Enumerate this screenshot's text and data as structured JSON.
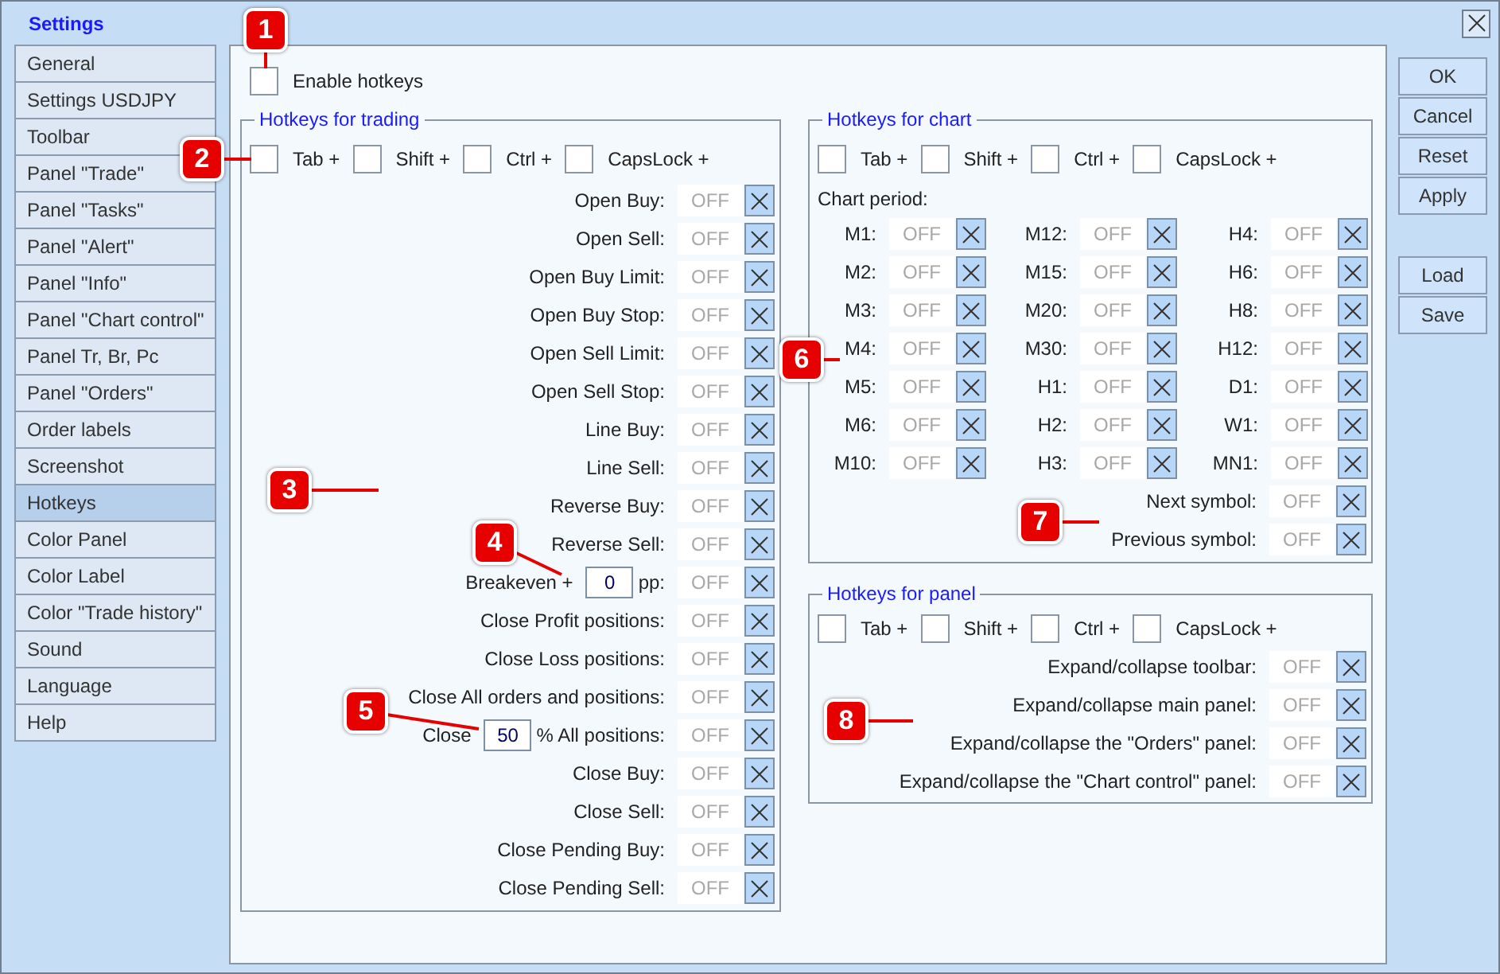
{
  "window": {
    "title": "Settings"
  },
  "sidebar": {
    "items": [
      {
        "label": "General",
        "selected": false
      },
      {
        "label": "Settings USDJPY",
        "selected": false
      },
      {
        "label": "Toolbar",
        "selected": false
      },
      {
        "label": "Panel \"Trade\"",
        "selected": false
      },
      {
        "label": "Panel \"Tasks\"",
        "selected": false
      },
      {
        "label": "Panel \"Alert\"",
        "selected": false
      },
      {
        "label": "Panel \"Info\"",
        "selected": false
      },
      {
        "label": "Panel \"Chart control\"",
        "selected": false
      },
      {
        "label": "Panel Tr, Br, Pc",
        "selected": false
      },
      {
        "label": "Panel \"Orders\"",
        "selected": false
      },
      {
        "label": "Order labels",
        "selected": false
      },
      {
        "label": "Screenshot",
        "selected": false
      },
      {
        "label": "Hotkeys",
        "selected": true
      },
      {
        "label": "Color Panel",
        "selected": false
      },
      {
        "label": "Color Label",
        "selected": false
      },
      {
        "label": "Color \"Trade history\"",
        "selected": false
      },
      {
        "label": "Sound",
        "selected": false
      },
      {
        "label": "Language",
        "selected": false
      },
      {
        "label": "Help",
        "selected": false
      }
    ]
  },
  "enable_hotkeys": {
    "label": "Enable hotkeys",
    "checked": false
  },
  "trading": {
    "title": "Hotkeys for trading",
    "modifiers": [
      {
        "label": "Tab +",
        "checked": false
      },
      {
        "label": "Shift +",
        "checked": false
      },
      {
        "label": "Ctrl +",
        "checked": false
      },
      {
        "label": "CapsLock +",
        "checked": false
      }
    ],
    "rows": [
      {
        "kind": "plain",
        "label": "Open Buy:",
        "value": "OFF"
      },
      {
        "kind": "plain",
        "label": "Open Sell:",
        "value": "OFF"
      },
      {
        "kind": "plain",
        "label": "Open Buy Limit:",
        "value": "OFF"
      },
      {
        "kind": "plain",
        "label": "Open Buy Stop:",
        "value": "OFF"
      },
      {
        "kind": "plain",
        "label": "Open Sell Limit:",
        "value": "OFF"
      },
      {
        "kind": "plain",
        "label": "Open Sell Stop:",
        "value": "OFF"
      },
      {
        "kind": "plain",
        "label": "Line Buy:",
        "value": "OFF"
      },
      {
        "kind": "plain",
        "label": "Line Sell:",
        "value": "OFF"
      },
      {
        "kind": "plain",
        "label": "Reverse Buy:",
        "value": "OFF"
      },
      {
        "kind": "plain",
        "label": "Reverse Sell:",
        "value": "OFF"
      },
      {
        "kind": "input",
        "prefix": "Breakeven +",
        "input": "0",
        "suffix": "pp:",
        "value": "OFF"
      },
      {
        "kind": "plain",
        "label": "Close Profit positions:",
        "value": "OFF"
      },
      {
        "kind": "plain",
        "label": "Close Loss positions:",
        "value": "OFF"
      },
      {
        "kind": "plain",
        "label": "Close All orders and positions:",
        "value": "OFF"
      },
      {
        "kind": "input",
        "prefix": "Close",
        "input": "50",
        "suffix": "% All positions:",
        "value": "OFF"
      },
      {
        "kind": "plain",
        "label": "Close Buy:",
        "value": "OFF"
      },
      {
        "kind": "plain",
        "label": "Close Sell:",
        "value": "OFF"
      },
      {
        "kind": "plain",
        "label": "Close Pending Buy:",
        "value": "OFF"
      },
      {
        "kind": "plain",
        "label": "Close Pending Sell:",
        "value": "OFF"
      }
    ]
  },
  "chart": {
    "title": "Hotkeys for chart",
    "modifiers": [
      {
        "label": "Tab +",
        "checked": false
      },
      {
        "label": "Shift +",
        "checked": false
      },
      {
        "label": "Ctrl +",
        "checked": false
      },
      {
        "label": "CapsLock +",
        "checked": false
      }
    ],
    "period_label": "Chart period:",
    "periods": [
      {
        "kind": "plain",
        "label": "M1:",
        "value": "OFF"
      },
      {
        "kind": "plain",
        "label": "M12:",
        "value": "OFF"
      },
      {
        "kind": "plain",
        "label": "H4:",
        "value": "OFF"
      },
      {
        "kind": "plain",
        "label": "M2:",
        "value": "OFF"
      },
      {
        "kind": "plain",
        "label": "M15:",
        "value": "OFF"
      },
      {
        "kind": "plain",
        "label": "H6:",
        "value": "OFF"
      },
      {
        "kind": "plain",
        "label": "M3:",
        "value": "OFF"
      },
      {
        "kind": "plain",
        "label": "M20:",
        "value": "OFF"
      },
      {
        "kind": "plain",
        "label": "H8:",
        "value": "OFF"
      },
      {
        "kind": "plain",
        "label": "M4:",
        "value": "OFF"
      },
      {
        "kind": "plain",
        "label": "M30:",
        "value": "OFF"
      },
      {
        "kind": "plain",
        "label": "H12:",
        "value": "OFF"
      },
      {
        "kind": "plain",
        "label": "M5:",
        "value": "OFF"
      },
      {
        "kind": "plain",
        "label": "H1:",
        "value": "OFF"
      },
      {
        "kind": "plain",
        "label": "D1:",
        "value": "OFF"
      },
      {
        "kind": "plain",
        "label": "M6:",
        "value": "OFF"
      },
      {
        "kind": "plain",
        "label": "H2:",
        "value": "OFF"
      },
      {
        "kind": "plain",
        "label": "W1:",
        "value": "OFF"
      },
      {
        "kind": "plain",
        "label": "M10:",
        "value": "OFF"
      },
      {
        "kind": "plain",
        "label": "H3:",
        "value": "OFF"
      },
      {
        "kind": "plain",
        "label": "MN1:",
        "value": "OFF"
      }
    ],
    "rows": [
      {
        "kind": "plain",
        "label": "Next symbol:",
        "value": "OFF"
      },
      {
        "kind": "plain",
        "label": "Previous symbol:",
        "value": "OFF"
      }
    ]
  },
  "panel": {
    "title": "Hotkeys for panel",
    "modifiers": [
      {
        "label": "Tab +",
        "checked": false
      },
      {
        "label": "Shift +",
        "checked": false
      },
      {
        "label": "Ctrl +",
        "checked": false
      },
      {
        "label": "CapsLock +",
        "checked": false
      }
    ],
    "rows": [
      {
        "kind": "plain",
        "label": "Expand/collapse toolbar:",
        "value": "OFF"
      },
      {
        "kind": "plain",
        "label": "Expand/collapse main panel:",
        "value": "OFF"
      },
      {
        "kind": "plain",
        "label": "Expand/collapse the \"Orders\" panel:",
        "value": "OFF"
      },
      {
        "kind": "plain",
        "label": "Expand/collapse the \"Chart control\" panel:",
        "value": "OFF"
      }
    ]
  },
  "buttons": [
    {
      "label": "OK"
    },
    {
      "label": "Cancel"
    },
    {
      "label": "Reset"
    },
    {
      "label": "Apply"
    }
  ],
  "file_buttons": [
    {
      "label": "Load"
    },
    {
      "label": "Save"
    }
  ],
  "callouts": [
    {
      "number": "1"
    },
    {
      "number": "2"
    },
    {
      "number": "3"
    },
    {
      "number": "4"
    },
    {
      "number": "5"
    },
    {
      "number": "6"
    },
    {
      "number": "7"
    },
    {
      "number": "8"
    }
  ]
}
